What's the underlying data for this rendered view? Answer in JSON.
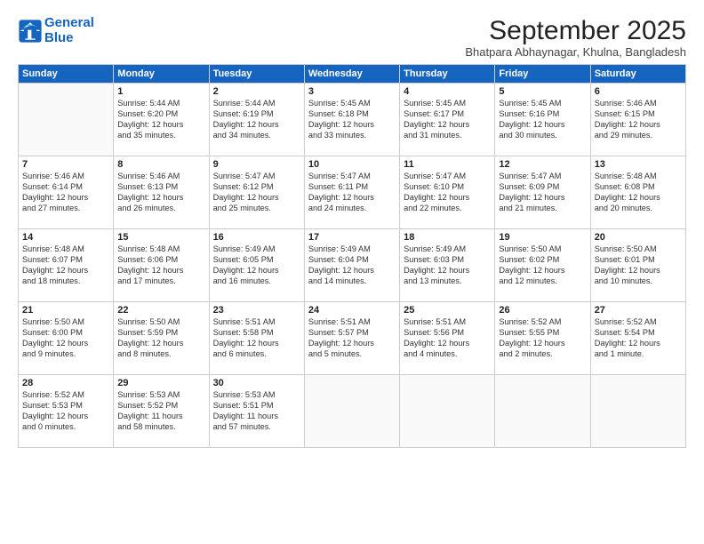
{
  "logo": {
    "line1": "General",
    "line2": "Blue"
  },
  "title": "September 2025",
  "location": "Bhatpara Abhaynagar, Khulna, Bangladesh",
  "headers": [
    "Sunday",
    "Monday",
    "Tuesday",
    "Wednesday",
    "Thursday",
    "Friday",
    "Saturday"
  ],
  "weeks": [
    [
      {
        "day": "",
        "content": ""
      },
      {
        "day": "1",
        "content": "Sunrise: 5:44 AM\nSunset: 6:20 PM\nDaylight: 12 hours\nand 35 minutes."
      },
      {
        "day": "2",
        "content": "Sunrise: 5:44 AM\nSunset: 6:19 PM\nDaylight: 12 hours\nand 34 minutes."
      },
      {
        "day": "3",
        "content": "Sunrise: 5:45 AM\nSunset: 6:18 PM\nDaylight: 12 hours\nand 33 minutes."
      },
      {
        "day": "4",
        "content": "Sunrise: 5:45 AM\nSunset: 6:17 PM\nDaylight: 12 hours\nand 31 minutes."
      },
      {
        "day": "5",
        "content": "Sunrise: 5:45 AM\nSunset: 6:16 PM\nDaylight: 12 hours\nand 30 minutes."
      },
      {
        "day": "6",
        "content": "Sunrise: 5:46 AM\nSunset: 6:15 PM\nDaylight: 12 hours\nand 29 minutes."
      }
    ],
    [
      {
        "day": "7",
        "content": "Sunrise: 5:46 AM\nSunset: 6:14 PM\nDaylight: 12 hours\nand 27 minutes."
      },
      {
        "day": "8",
        "content": "Sunrise: 5:46 AM\nSunset: 6:13 PM\nDaylight: 12 hours\nand 26 minutes."
      },
      {
        "day": "9",
        "content": "Sunrise: 5:47 AM\nSunset: 6:12 PM\nDaylight: 12 hours\nand 25 minutes."
      },
      {
        "day": "10",
        "content": "Sunrise: 5:47 AM\nSunset: 6:11 PM\nDaylight: 12 hours\nand 24 minutes."
      },
      {
        "day": "11",
        "content": "Sunrise: 5:47 AM\nSunset: 6:10 PM\nDaylight: 12 hours\nand 22 minutes."
      },
      {
        "day": "12",
        "content": "Sunrise: 5:47 AM\nSunset: 6:09 PM\nDaylight: 12 hours\nand 21 minutes."
      },
      {
        "day": "13",
        "content": "Sunrise: 5:48 AM\nSunset: 6:08 PM\nDaylight: 12 hours\nand 20 minutes."
      }
    ],
    [
      {
        "day": "14",
        "content": "Sunrise: 5:48 AM\nSunset: 6:07 PM\nDaylight: 12 hours\nand 18 minutes."
      },
      {
        "day": "15",
        "content": "Sunrise: 5:48 AM\nSunset: 6:06 PM\nDaylight: 12 hours\nand 17 minutes."
      },
      {
        "day": "16",
        "content": "Sunrise: 5:49 AM\nSunset: 6:05 PM\nDaylight: 12 hours\nand 16 minutes."
      },
      {
        "day": "17",
        "content": "Sunrise: 5:49 AM\nSunset: 6:04 PM\nDaylight: 12 hours\nand 14 minutes."
      },
      {
        "day": "18",
        "content": "Sunrise: 5:49 AM\nSunset: 6:03 PM\nDaylight: 12 hours\nand 13 minutes."
      },
      {
        "day": "19",
        "content": "Sunrise: 5:50 AM\nSunset: 6:02 PM\nDaylight: 12 hours\nand 12 minutes."
      },
      {
        "day": "20",
        "content": "Sunrise: 5:50 AM\nSunset: 6:01 PM\nDaylight: 12 hours\nand 10 minutes."
      }
    ],
    [
      {
        "day": "21",
        "content": "Sunrise: 5:50 AM\nSunset: 6:00 PM\nDaylight: 12 hours\nand 9 minutes."
      },
      {
        "day": "22",
        "content": "Sunrise: 5:50 AM\nSunset: 5:59 PM\nDaylight: 12 hours\nand 8 minutes."
      },
      {
        "day": "23",
        "content": "Sunrise: 5:51 AM\nSunset: 5:58 PM\nDaylight: 12 hours\nand 6 minutes."
      },
      {
        "day": "24",
        "content": "Sunrise: 5:51 AM\nSunset: 5:57 PM\nDaylight: 12 hours\nand 5 minutes."
      },
      {
        "day": "25",
        "content": "Sunrise: 5:51 AM\nSunset: 5:56 PM\nDaylight: 12 hours\nand 4 minutes."
      },
      {
        "day": "26",
        "content": "Sunrise: 5:52 AM\nSunset: 5:55 PM\nDaylight: 12 hours\nand 2 minutes."
      },
      {
        "day": "27",
        "content": "Sunrise: 5:52 AM\nSunset: 5:54 PM\nDaylight: 12 hours\nand 1 minute."
      }
    ],
    [
      {
        "day": "28",
        "content": "Sunrise: 5:52 AM\nSunset: 5:53 PM\nDaylight: 12 hours\nand 0 minutes."
      },
      {
        "day": "29",
        "content": "Sunrise: 5:53 AM\nSunset: 5:52 PM\nDaylight: 11 hours\nand 58 minutes."
      },
      {
        "day": "30",
        "content": "Sunrise: 5:53 AM\nSunset: 5:51 PM\nDaylight: 11 hours\nand 57 minutes."
      },
      {
        "day": "",
        "content": ""
      },
      {
        "day": "",
        "content": ""
      },
      {
        "day": "",
        "content": ""
      },
      {
        "day": "",
        "content": ""
      }
    ]
  ]
}
